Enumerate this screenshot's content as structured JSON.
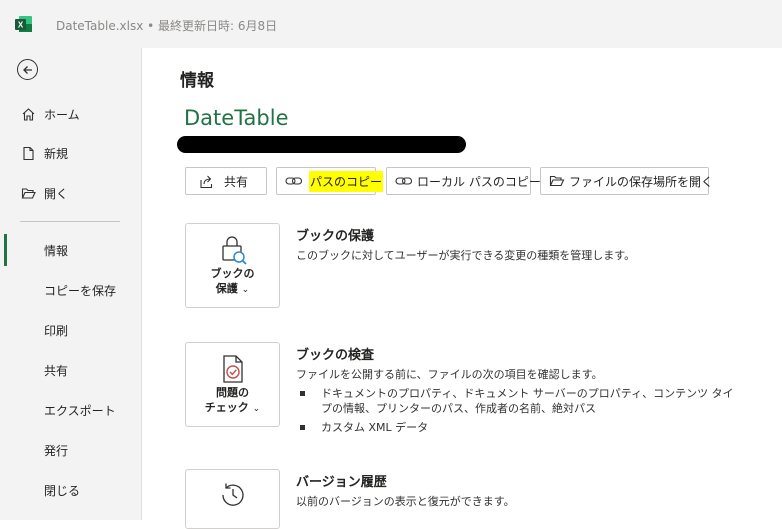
{
  "title": {
    "text": "DateTable.xlsx • 最終更新日時: 6月8日",
    "app_icon": "excel-icon"
  },
  "sidebar": {
    "back_icon": "back-arrow-icon",
    "items": [
      {
        "label": "ホーム",
        "icon": "home-icon"
      },
      {
        "label": "新規",
        "icon": "new-file-icon"
      },
      {
        "label": "開く",
        "icon": "folder-open-icon"
      },
      {
        "label": "情報",
        "active": true
      },
      {
        "label": "コピーを保存"
      },
      {
        "label": "印刷"
      },
      {
        "label": "共有"
      },
      {
        "label": "エクスポート"
      },
      {
        "label": "発行"
      },
      {
        "label": "閉じる"
      }
    ],
    "accent": "#217346"
  },
  "main": {
    "page_title": "情報",
    "file_name": "DateTable",
    "buttons": [
      {
        "label": "共有",
        "icon": "share-icon"
      },
      {
        "label": "パスのコピー",
        "icon": "link-icon",
        "highlighted": true
      },
      {
        "label": "ローカル パスのコピー",
        "icon": "link-icon"
      },
      {
        "label": "ファイルの保存場所を開く",
        "icon": "folder-open-icon"
      }
    ],
    "sections": [
      {
        "card_label_1": "ブックの",
        "card_label_2": "保護",
        "icon": "lock-search-icon",
        "title": "ブックの保護",
        "desc": "このブックに対してユーザーが実行できる変更の種類を管理します。"
      },
      {
        "card_label_1": "問題の",
        "card_label_2": "チェック",
        "icon": "document-check-icon",
        "title": "ブックの検査",
        "desc": "ファイルを公開する前に、ファイルの次の項目を確認します。",
        "bullets": [
          "ドキュメントのプロパティ、ドキュメント サーバーのプロパティ、コンテンツ タイプの情報、プリンターのパス、作成者の名前、絶対パス",
          "カスタム XML データ"
        ]
      },
      {
        "icon": "history-icon",
        "title": "バージョン履歴",
        "desc": "以前のバージョンの表示と復元ができます。"
      }
    ],
    "highlight_color": "#ffff00"
  }
}
